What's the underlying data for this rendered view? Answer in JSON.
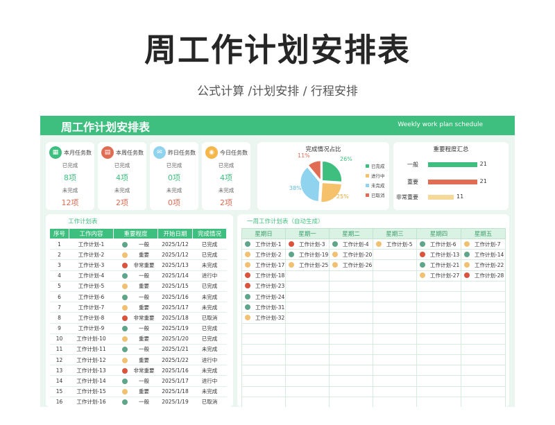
{
  "page": {
    "title": "周工作计划安排表",
    "subtitle": "公式计算 /计划安排 / 行程安排"
  },
  "banner": {
    "title": "周工作计划安排表",
    "subtitle": "Weekly work plan schedule"
  },
  "colors": {
    "green": "#3fbf7f",
    "red": "#e06c54",
    "yellow": "#f5c26b",
    "blue": "#8fd3ef",
    "dot_important": "#f0c172",
    "dot_very": "#d9533d",
    "dot_normal": "#5fa58a"
  },
  "cards": [
    {
      "label": "本月任务数",
      "icon": "calendar-icon",
      "icon_char": "▦",
      "color": "#3fbf7f",
      "done_label": "已完成",
      "done": "8项",
      "todo_label": "未完成",
      "todo": "12项"
    },
    {
      "label": "本周任务数",
      "icon": "clipboard-icon",
      "icon_char": "▤",
      "color": "#e06c54",
      "done_label": "已完成",
      "done": "4项",
      "todo_label": "未完成",
      "todo": "2项"
    },
    {
      "label": "昨日任务数",
      "icon": "mail-icon",
      "icon_char": "✉",
      "color": "#8fd3ef",
      "done_label": "已完成",
      "done": "0项",
      "todo_label": "未完成",
      "todo": "0项"
    },
    {
      "label": "今日任务数",
      "icon": "coin-icon",
      "icon_char": "◉",
      "color": "#f5b64a",
      "done_label": "已完成",
      "done": "4项",
      "todo_label": "未完成",
      "todo": "2项"
    }
  ],
  "chart_data": [
    {
      "type": "pie",
      "title": "完成情况占比",
      "categories": [
        "已完成",
        "进行中",
        "未完成",
        "已取消"
      ],
      "values": [
        26,
        25,
        38,
        11
      ],
      "value_labels": [
        "26%",
        "25%",
        "38%",
        "11%"
      ],
      "colors": [
        "#3fbf7f",
        "#f5c26b",
        "#8fd3ef",
        "#e06c54"
      ],
      "legend": "right"
    },
    {
      "type": "bar",
      "orientation": "horizontal",
      "title": "重要程度汇总",
      "categories": [
        "一般",
        "重要",
        "非常重要"
      ],
      "values": [
        21,
        21,
        11
      ],
      "colors": [
        "#3fbf7f",
        "#e06c54",
        "#f5d99a"
      ],
      "xlim": [
        0,
        22
      ]
    }
  ],
  "task_table": {
    "title": "工作计划表",
    "headers": [
      "序号",
      "工作内容",
      "重要程度",
      "开始日期",
      "完成情况"
    ],
    "rows": [
      {
        "no": "1",
        "name": "工作计划-1",
        "level": "一般",
        "date": "2025/1/12",
        "status": "已完成"
      },
      {
        "no": "2",
        "name": "工作计划-2",
        "level": "重要",
        "date": "2025/1/12",
        "status": "已完成"
      },
      {
        "no": "3",
        "name": "工作计划-3",
        "level": "非常重要",
        "date": "2025/1/13",
        "status": "未完成"
      },
      {
        "no": "4",
        "name": "工作计划-4",
        "level": "一般",
        "date": "2025/1/14",
        "status": "进行中"
      },
      {
        "no": "5",
        "name": "工作计划-5",
        "level": "重要",
        "date": "2025/1/15",
        "status": "已完成"
      },
      {
        "no": "6",
        "name": "工作计划-6",
        "level": "一般",
        "date": "2025/1/16",
        "status": "未完成"
      },
      {
        "no": "7",
        "name": "工作计划-7",
        "level": "重要",
        "date": "2025/1/17",
        "status": "未完成"
      },
      {
        "no": "8",
        "name": "工作计划-8",
        "level": "非常重要",
        "date": "2025/1/18",
        "status": "已取消"
      },
      {
        "no": "9",
        "name": "工作计划-9",
        "level": "一般",
        "date": "2025/1/19",
        "status": "已完成"
      },
      {
        "no": "10",
        "name": "工作计划-10",
        "level": "重要",
        "date": "2025/1/20",
        "status": "已完成"
      },
      {
        "no": "11",
        "name": "工作计划-11",
        "level": "一般",
        "date": "2025/1/21",
        "status": "未完成"
      },
      {
        "no": "12",
        "name": "工作计划-12",
        "level": "重要",
        "date": "2025/1/22",
        "status": "进行中"
      },
      {
        "no": "13",
        "name": "工作计划-13",
        "level": "非常重要",
        "date": "2025/1/16",
        "status": "未完成"
      },
      {
        "no": "14",
        "name": "工作计划-14",
        "level": "一般",
        "date": "2025/1/17",
        "status": "进行中"
      },
      {
        "no": "15",
        "name": "工作计划-15",
        "level": "重要",
        "date": "2025/1/18",
        "status": "未完成"
      },
      {
        "no": "16",
        "name": "工作计划-16",
        "level": "一般",
        "date": "2025/1/19",
        "status": "已取消"
      }
    ]
  },
  "week_table": {
    "title": "一周工作计划表（自动生成）",
    "headers": [
      "星期日",
      "星期一",
      "星期二",
      "星期三",
      "星期四",
      "星期五"
    ],
    "columns": [
      [
        {
          "text": "工作计划-1",
          "level": "一般"
        },
        {
          "text": "工作计划-2",
          "level": "重要"
        },
        {
          "text": "工作计划-17",
          "level": "重要"
        },
        {
          "text": "工作计划-18",
          "level": "非常重要"
        },
        {
          "text": "工作计划-23",
          "level": "非常重要"
        },
        {
          "text": "工作计划-24",
          "level": "一般"
        },
        {
          "text": "工作计划-31",
          "level": "一般"
        },
        {
          "text": "工作计划-32",
          "level": "重要"
        }
      ],
      [
        {
          "text": "工作计划-3",
          "level": "非常重要"
        },
        {
          "text": "工作计划-19",
          "level": "一般"
        },
        {
          "text": "工作计划-25",
          "level": "重要"
        }
      ],
      [
        {
          "text": "工作计划-4",
          "level": "一般"
        },
        {
          "text": "工作计划-20",
          "level": "重要"
        },
        {
          "text": "工作计划-26",
          "level": "重要"
        }
      ],
      [
        {
          "text": "工作计划-5",
          "level": "重要"
        }
      ],
      [
        {
          "text": "工作计划-6",
          "level": "一般"
        },
        {
          "text": "工作计划-13",
          "level": "非常重要"
        },
        {
          "text": "工作计划-21",
          "level": "一般"
        },
        {
          "text": "工作计划-27",
          "level": "重要"
        }
      ],
      [
        {
          "text": "工作计划-7",
          "level": "重要"
        },
        {
          "text": "工作计划-14",
          "level": "一般"
        },
        {
          "text": "工作计划-22",
          "level": "重要"
        },
        {
          "text": "工作计划-28",
          "level": "非常重要"
        }
      ]
    ]
  }
}
